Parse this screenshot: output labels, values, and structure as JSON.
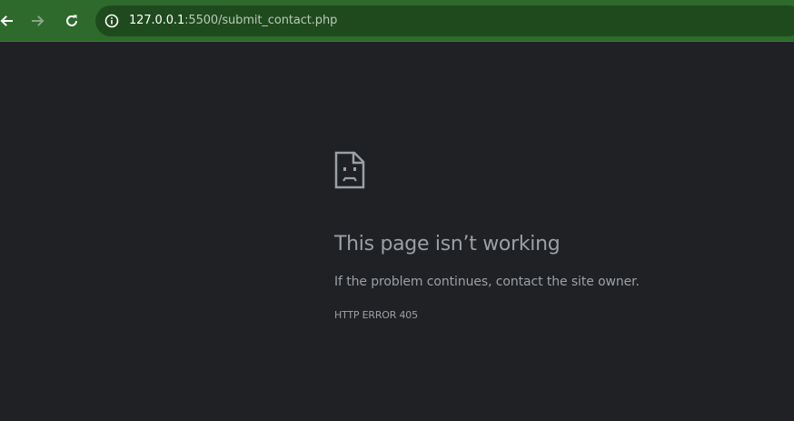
{
  "browser": {
    "toolbar_color": "#2e6a2c",
    "omnibox_color": "#1f4a1e",
    "back_icon": "arrow-left-icon",
    "forward_icon": "arrow-right-icon",
    "reload_icon": "reload-icon",
    "site_info_icon": "info-icon",
    "url_host": "127.0.0.1",
    "url_rest": ":5500/submit_contact.php"
  },
  "error_page": {
    "icon": "sad-page-icon",
    "title": "This page isn’t working",
    "description": "If the problem continues, contact the site owner.",
    "error_code": "HTTP ERROR 405",
    "background_color": "#202124",
    "text_color": "#9aa0a6"
  }
}
